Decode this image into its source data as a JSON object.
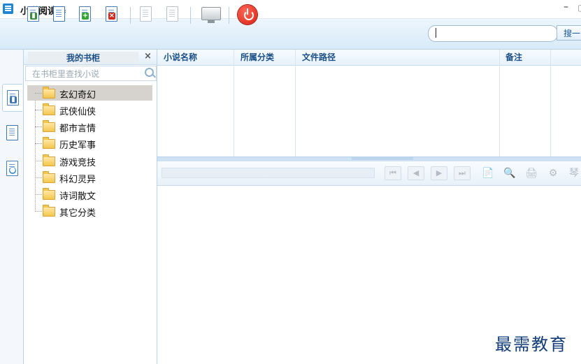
{
  "app": {
    "title": "小说阅读器",
    "minimize_label": "–",
    "extra_label": "▢"
  },
  "toolbar": {
    "search_value": "",
    "search_button_label": "搜一"
  },
  "shelf": {
    "title": "我的书柜",
    "close_label": "×",
    "search_placeholder": "在书柜里查找小说",
    "categories": [
      "玄幻奇幻",
      "武侠仙侠",
      "都市言情",
      "历史军事",
      "游戏竞技",
      "科幻灵异",
      "诗词散文",
      "其它分类"
    ]
  },
  "table": {
    "columns": [
      "小说名称",
      "所属分类",
      "文件路径",
      "备注"
    ]
  },
  "reader": {
    "nav": [
      "⏮",
      "◀",
      "▶",
      "⏭"
    ],
    "tools": [
      "📄",
      "🔍",
      "🖨",
      "⚙",
      "琴"
    ]
  },
  "watermark": "最需教育",
  "colors": {
    "accent": "#1a4f86",
    "exit_red": "#d81e10",
    "selection": "#d6d3ce"
  }
}
